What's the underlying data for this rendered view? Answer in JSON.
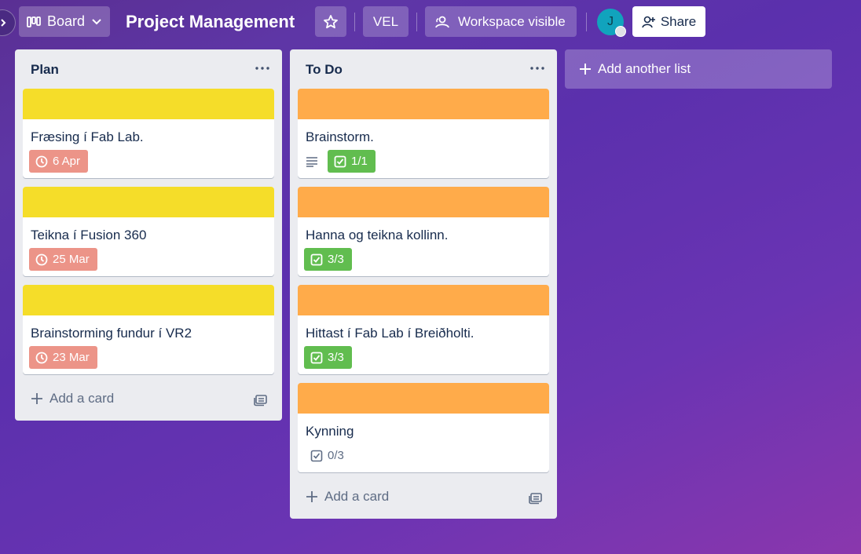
{
  "header": {
    "view_label": "Board",
    "board_title": "Project Management",
    "workspace_label": "VEL",
    "visibility_label": "Workspace visible",
    "avatar_initial": "J",
    "share_label": "Share"
  },
  "lists": [
    {
      "title": "Plan",
      "cover_color": "#f5dd29",
      "cards": [
        {
          "title": "Fræsing í Fab Lab.",
          "due": "6 Apr"
        },
        {
          "title": "Teikna í Fusion 360",
          "due": "25 Mar"
        },
        {
          "title": "Brainstorming fundur í VR2",
          "due": "23 Mar"
        }
      ],
      "add_card_label": "Add a card"
    },
    {
      "title": "To Do",
      "cover_color": "#ffab4a",
      "cards": [
        {
          "title": "Brainstorm.",
          "has_description": true,
          "checklist": "1/1"
        },
        {
          "title": "Hanna og teikna kollinn.",
          "checklist": "3/3"
        },
        {
          "title": "Hittast í Fab Lab í Breiðholti.",
          "checklist": "3/3"
        },
        {
          "title": "Kynning",
          "checklist": "0/3"
        }
      ],
      "add_card_label": "Add a card"
    }
  ],
  "add_list_label": "Add another list",
  "icons": {
    "board": "board-icon",
    "chevron": "chevron-down-icon",
    "star": "star-icon",
    "visibility": "people-icon",
    "share": "add-person-icon",
    "menu": "more-icon",
    "clock": "clock-icon",
    "checklist": "checklist-icon",
    "description": "description-icon",
    "plus": "plus-icon",
    "template": "card-template-icon"
  },
  "colors": {
    "due_badge": "#ec9488",
    "checklist_complete": "#61bd4f",
    "plan_cover": "#f5dd29",
    "todo_cover": "#ffab4a"
  }
}
